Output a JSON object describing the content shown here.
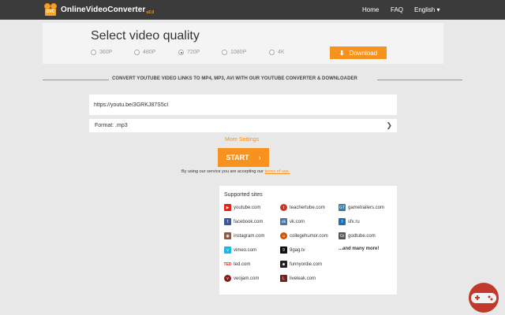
{
  "header": {
    "logo_text": "OnlineVideoConverter",
    "logo_badge": "OVC",
    "logo_version": "v2.0",
    "nav": {
      "home": "Home",
      "faq": "FAQ",
      "language": "English ▾"
    }
  },
  "quality": {
    "title": "Select video quality",
    "options": [
      {
        "label": "360P",
        "selected": false
      },
      {
        "label": "480P",
        "selected": false
      },
      {
        "label": "720P",
        "selected": true
      },
      {
        "label": "1080P",
        "selected": false
      },
      {
        "label": "4K",
        "selected": false
      }
    ],
    "download_label": "Download"
  },
  "converter": {
    "heading": "CONVERT YOUTUBE VIDEO LINKS TO MP4, MP3, AVI WITH OUR YOUTUBE CONVERTER & DOWNLOADER",
    "url_value": "https://youtu.be/3GRKJ87S5cI",
    "format_label": "Format: .mp3",
    "more_settings": "More Settings",
    "start_label": "START",
    "terms_prefix": "By using our service you are accepting our ",
    "terms_link": "terms of use."
  },
  "supported": {
    "title": "Supported sites",
    "sites": [
      {
        "name": "youtube.com",
        "icon": "youtube-icon",
        "color": "#e62117"
      },
      {
        "name": "teachertube.com",
        "icon": "teachertube-icon",
        "color": "#c0392b"
      },
      {
        "name": "gametrailers.com",
        "icon": "gametrailers-icon",
        "color": "#3a7ca5"
      },
      {
        "name": "facebook.com",
        "icon": "facebook-icon",
        "color": "#3b5998"
      },
      {
        "name": "vk.com",
        "icon": "vk-icon",
        "color": "#4a76a8"
      },
      {
        "name": "sfx.ru",
        "icon": "sfx-icon",
        "color": "#1e6fb8"
      },
      {
        "name": "instagram.com",
        "icon": "instagram-icon",
        "color": "#8a5a44"
      },
      {
        "name": "collegehumor.com",
        "icon": "collegehumor-icon",
        "color": "#d35400"
      },
      {
        "name": "godtube.com",
        "icon": "godtube-icon",
        "color": "#555555"
      },
      {
        "name": "vimeo.com",
        "icon": "vimeo-icon",
        "color": "#1ab7ea"
      },
      {
        "name": "9gag.tv",
        "icon": "9gag-icon",
        "color": "#111111"
      },
      {
        "name": "...and many more!",
        "icon": "",
        "color": ""
      },
      {
        "name": "ted.com",
        "icon": "ted-icon",
        "color": "#e62b1e"
      },
      {
        "name": "funnyordie.com",
        "icon": "funnyordie-icon",
        "color": "#222222"
      },
      {
        "name": "veojam.com",
        "icon": "veojam-icon",
        "color": "#8b1a1a"
      },
      {
        "name": "liveleak.com",
        "icon": "liveleak-icon",
        "color": "#7a1f1f"
      }
    ]
  }
}
